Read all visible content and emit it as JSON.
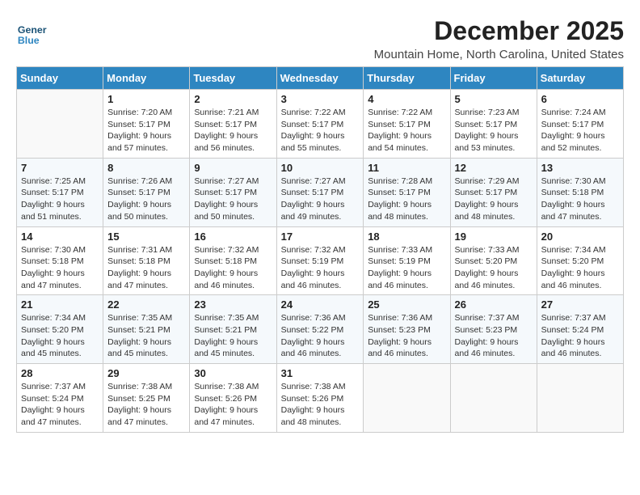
{
  "logo": {
    "general": "General",
    "blue": "Blue"
  },
  "title": "December 2025",
  "location": "Mountain Home, North Carolina, United States",
  "days_of_week": [
    "Sunday",
    "Monday",
    "Tuesday",
    "Wednesday",
    "Thursday",
    "Friday",
    "Saturday"
  ],
  "weeks": [
    [
      {
        "day": "",
        "info": ""
      },
      {
        "day": "1",
        "info": "Sunrise: 7:20 AM\nSunset: 5:17 PM\nDaylight: 9 hours\nand 57 minutes."
      },
      {
        "day": "2",
        "info": "Sunrise: 7:21 AM\nSunset: 5:17 PM\nDaylight: 9 hours\nand 56 minutes."
      },
      {
        "day": "3",
        "info": "Sunrise: 7:22 AM\nSunset: 5:17 PM\nDaylight: 9 hours\nand 55 minutes."
      },
      {
        "day": "4",
        "info": "Sunrise: 7:22 AM\nSunset: 5:17 PM\nDaylight: 9 hours\nand 54 minutes."
      },
      {
        "day": "5",
        "info": "Sunrise: 7:23 AM\nSunset: 5:17 PM\nDaylight: 9 hours\nand 53 minutes."
      },
      {
        "day": "6",
        "info": "Sunrise: 7:24 AM\nSunset: 5:17 PM\nDaylight: 9 hours\nand 52 minutes."
      }
    ],
    [
      {
        "day": "7",
        "info": "Sunrise: 7:25 AM\nSunset: 5:17 PM\nDaylight: 9 hours\nand 51 minutes."
      },
      {
        "day": "8",
        "info": "Sunrise: 7:26 AM\nSunset: 5:17 PM\nDaylight: 9 hours\nand 50 minutes."
      },
      {
        "day": "9",
        "info": "Sunrise: 7:27 AM\nSunset: 5:17 PM\nDaylight: 9 hours\nand 50 minutes."
      },
      {
        "day": "10",
        "info": "Sunrise: 7:27 AM\nSunset: 5:17 PM\nDaylight: 9 hours\nand 49 minutes."
      },
      {
        "day": "11",
        "info": "Sunrise: 7:28 AM\nSunset: 5:17 PM\nDaylight: 9 hours\nand 48 minutes."
      },
      {
        "day": "12",
        "info": "Sunrise: 7:29 AM\nSunset: 5:17 PM\nDaylight: 9 hours\nand 48 minutes."
      },
      {
        "day": "13",
        "info": "Sunrise: 7:30 AM\nSunset: 5:18 PM\nDaylight: 9 hours\nand 47 minutes."
      }
    ],
    [
      {
        "day": "14",
        "info": "Sunrise: 7:30 AM\nSunset: 5:18 PM\nDaylight: 9 hours\nand 47 minutes."
      },
      {
        "day": "15",
        "info": "Sunrise: 7:31 AM\nSunset: 5:18 PM\nDaylight: 9 hours\nand 47 minutes."
      },
      {
        "day": "16",
        "info": "Sunrise: 7:32 AM\nSunset: 5:18 PM\nDaylight: 9 hours\nand 46 minutes."
      },
      {
        "day": "17",
        "info": "Sunrise: 7:32 AM\nSunset: 5:19 PM\nDaylight: 9 hours\nand 46 minutes."
      },
      {
        "day": "18",
        "info": "Sunrise: 7:33 AM\nSunset: 5:19 PM\nDaylight: 9 hours\nand 46 minutes."
      },
      {
        "day": "19",
        "info": "Sunrise: 7:33 AM\nSunset: 5:20 PM\nDaylight: 9 hours\nand 46 minutes."
      },
      {
        "day": "20",
        "info": "Sunrise: 7:34 AM\nSunset: 5:20 PM\nDaylight: 9 hours\nand 46 minutes."
      }
    ],
    [
      {
        "day": "21",
        "info": "Sunrise: 7:34 AM\nSunset: 5:20 PM\nDaylight: 9 hours\nand 45 minutes."
      },
      {
        "day": "22",
        "info": "Sunrise: 7:35 AM\nSunset: 5:21 PM\nDaylight: 9 hours\nand 45 minutes."
      },
      {
        "day": "23",
        "info": "Sunrise: 7:35 AM\nSunset: 5:21 PM\nDaylight: 9 hours\nand 45 minutes."
      },
      {
        "day": "24",
        "info": "Sunrise: 7:36 AM\nSunset: 5:22 PM\nDaylight: 9 hours\nand 46 minutes."
      },
      {
        "day": "25",
        "info": "Sunrise: 7:36 AM\nSunset: 5:23 PM\nDaylight: 9 hours\nand 46 minutes."
      },
      {
        "day": "26",
        "info": "Sunrise: 7:37 AM\nSunset: 5:23 PM\nDaylight: 9 hours\nand 46 minutes."
      },
      {
        "day": "27",
        "info": "Sunrise: 7:37 AM\nSunset: 5:24 PM\nDaylight: 9 hours\nand 46 minutes."
      }
    ],
    [
      {
        "day": "28",
        "info": "Sunrise: 7:37 AM\nSunset: 5:24 PM\nDaylight: 9 hours\nand 47 minutes."
      },
      {
        "day": "29",
        "info": "Sunrise: 7:38 AM\nSunset: 5:25 PM\nDaylight: 9 hours\nand 47 minutes."
      },
      {
        "day": "30",
        "info": "Sunrise: 7:38 AM\nSunset: 5:26 PM\nDaylight: 9 hours\nand 47 minutes."
      },
      {
        "day": "31",
        "info": "Sunrise: 7:38 AM\nSunset: 5:26 PM\nDaylight: 9 hours\nand 48 minutes."
      },
      {
        "day": "",
        "info": ""
      },
      {
        "day": "",
        "info": ""
      },
      {
        "day": "",
        "info": ""
      }
    ]
  ]
}
